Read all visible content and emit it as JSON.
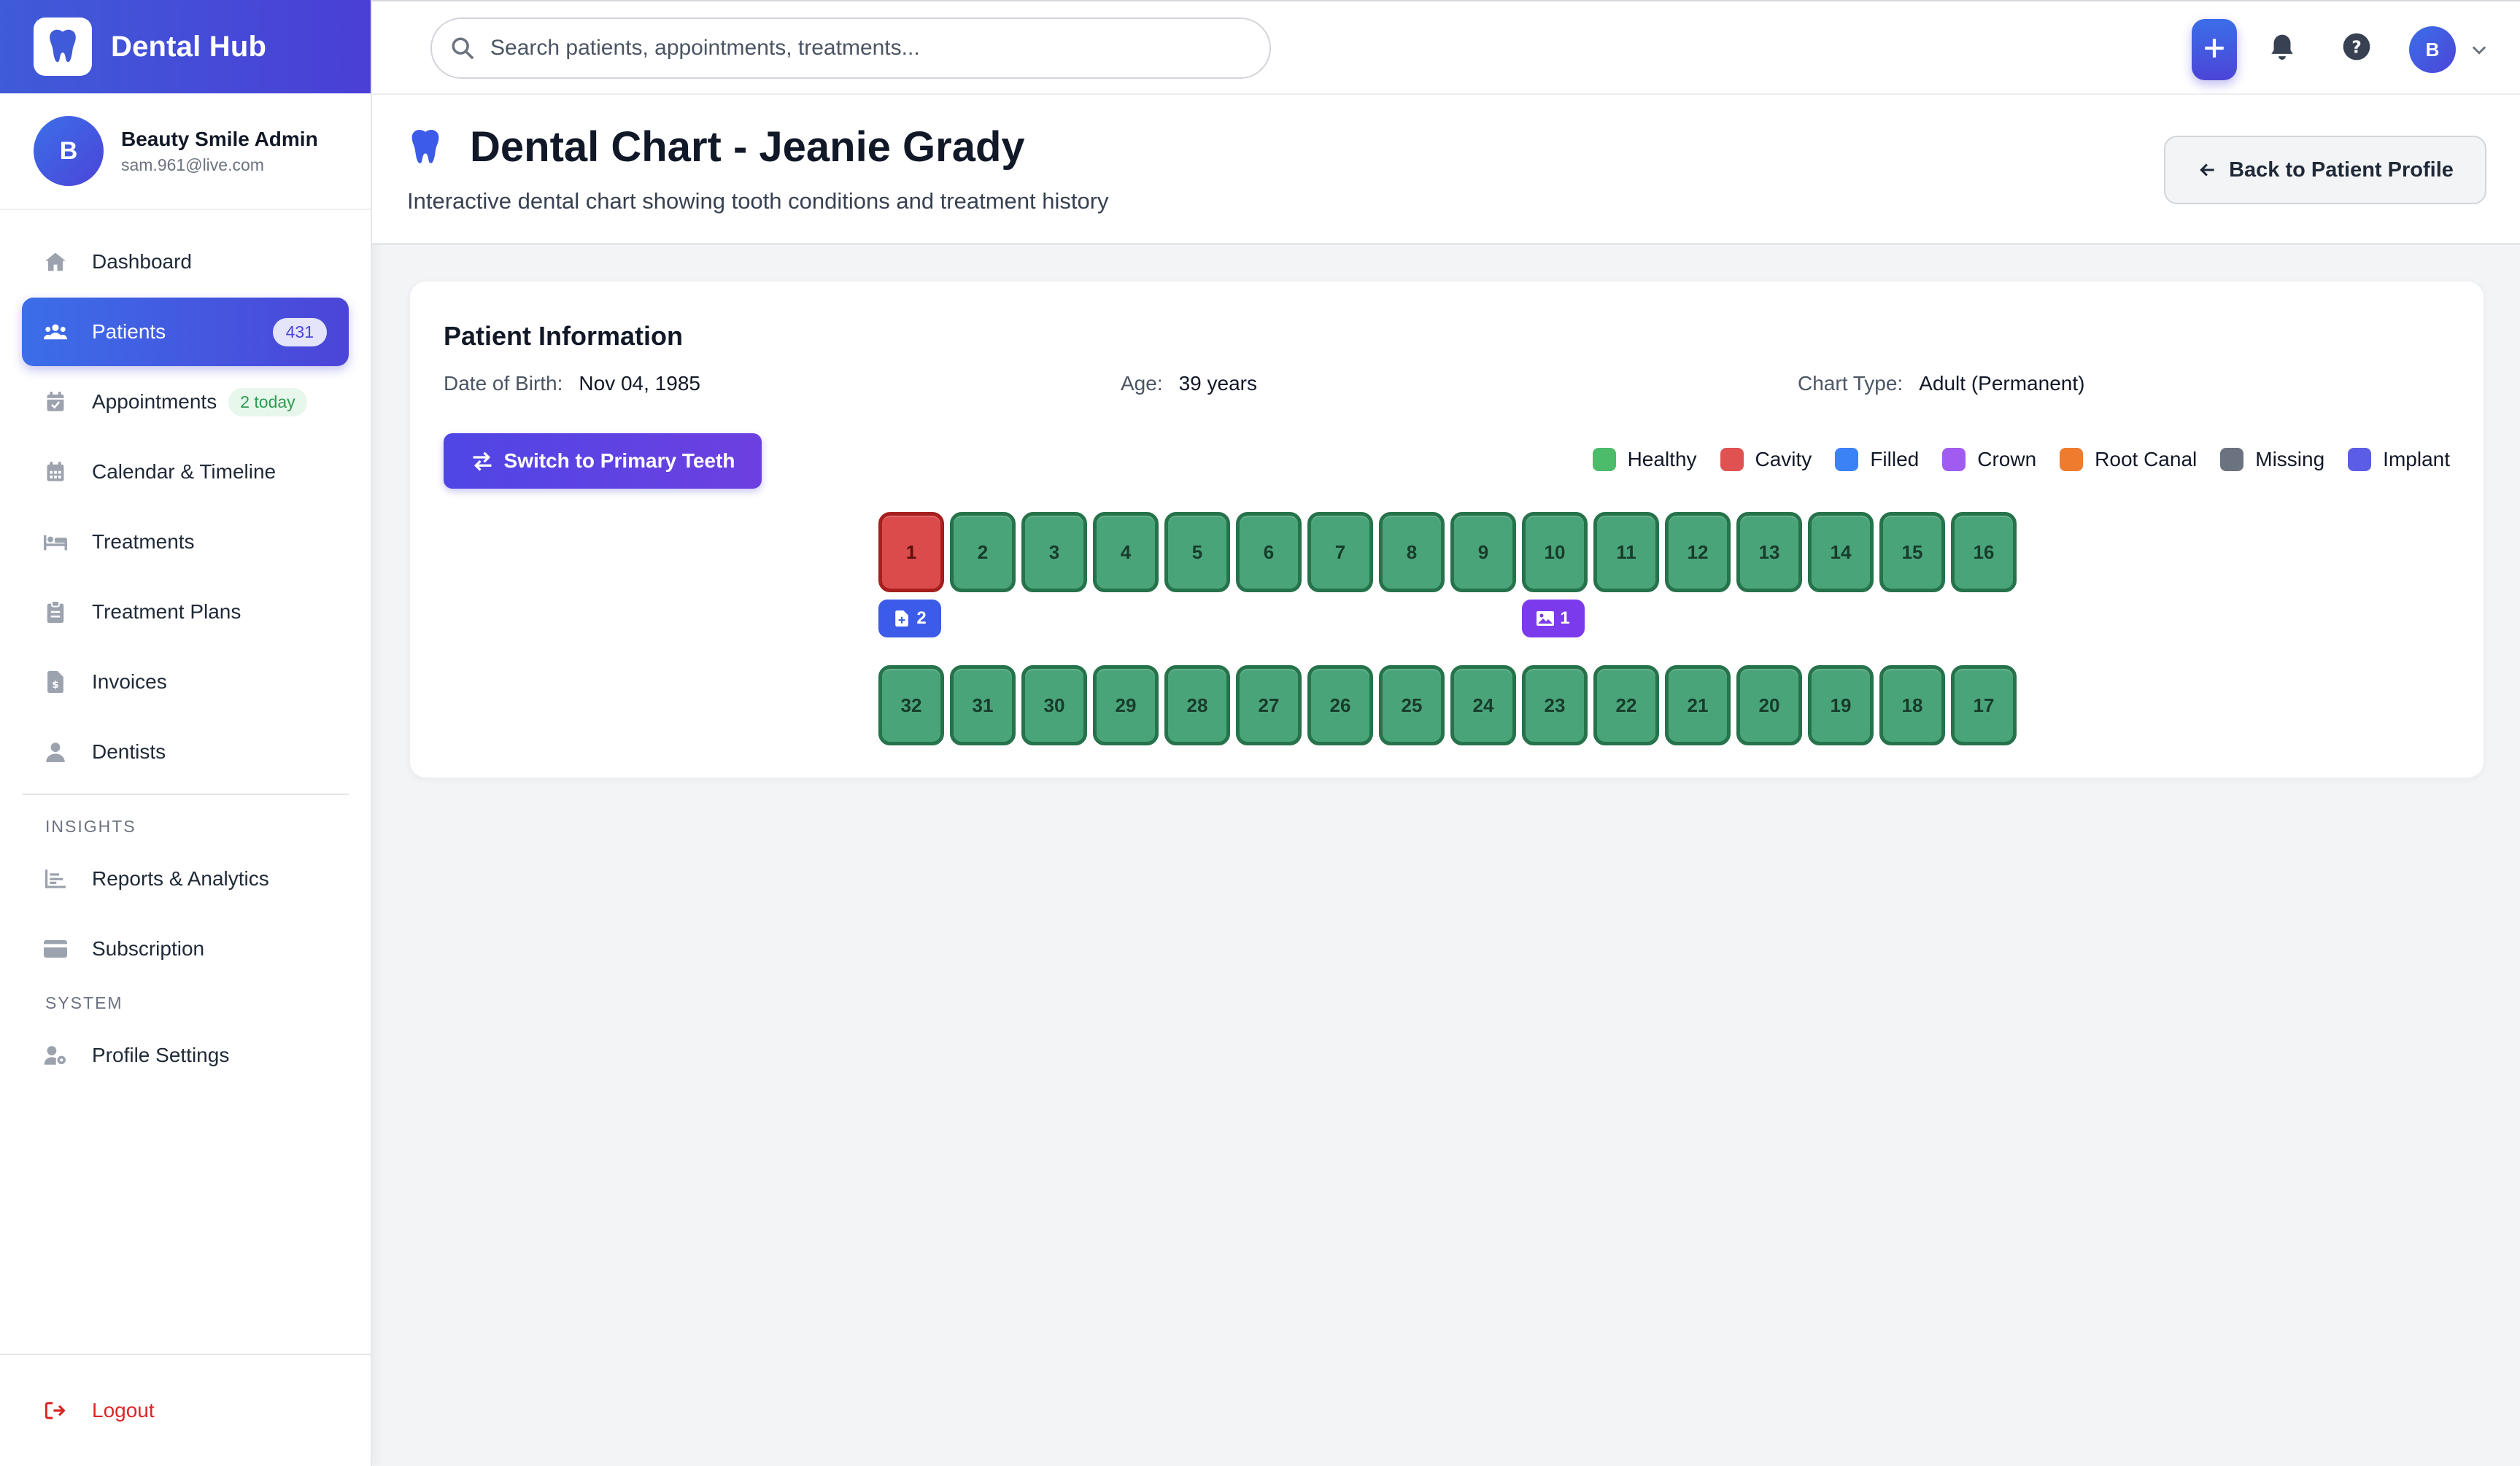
{
  "brand": {
    "name": "Dental Hub"
  },
  "user": {
    "initial": "B",
    "name": "Beauty Smile Admin",
    "email": "sam.961@live.com"
  },
  "nav": {
    "items": [
      {
        "label": "Dashboard",
        "icon": "home-icon"
      },
      {
        "label": "Patients",
        "icon": "users-icon",
        "badge": "431",
        "active": true
      },
      {
        "label": "Appointments",
        "icon": "calendar-check-icon",
        "badge": "2 today"
      },
      {
        "label": "Calendar & Timeline",
        "icon": "calendar-icon"
      },
      {
        "label": "Treatments",
        "icon": "treatment-bed-icon"
      },
      {
        "label": "Treatment Plans",
        "icon": "clipboard-icon"
      },
      {
        "label": "Invoices",
        "icon": "invoice-icon"
      },
      {
        "label": "Dentists",
        "icon": "user-md-icon"
      }
    ],
    "insights_label": "INSIGHTS",
    "insights": [
      {
        "label": "Reports & Analytics",
        "icon": "chart-icon"
      },
      {
        "label": "Subscription",
        "icon": "credit-card-icon"
      }
    ],
    "system_label": "SYSTEM",
    "system": [
      {
        "label": "Profile Settings",
        "icon": "user-cog-icon"
      }
    ],
    "logout": "Logout"
  },
  "topbar": {
    "search_placeholder": "Search patients, appointments, treatments...",
    "avatar_initial": "B"
  },
  "header": {
    "title": "Dental Chart - Jeanie Grady",
    "subtitle": "Interactive dental chart showing tooth conditions and treatment history",
    "back_label": "Back to Patient Profile"
  },
  "patient_info": {
    "title": "Patient Information",
    "dob_label": "Date of Birth:",
    "dob_value": "Nov 04, 1985",
    "age_label": "Age:",
    "age_value": "39 years",
    "chart_type_label": "Chart Type:",
    "chart_type_value": "Adult (Permanent)"
  },
  "chart": {
    "switch_label": "Switch to Primary Teeth",
    "legend": [
      {
        "label": "Healthy",
        "color": "#4cbc6a"
      },
      {
        "label": "Cavity",
        "color": "#e05252"
      },
      {
        "label": "Filled",
        "color": "#3b82f6"
      },
      {
        "label": "Crown",
        "color": "#a05cf0"
      },
      {
        "label": "Root Canal",
        "color": "#ef7b2e"
      },
      {
        "label": "Missing",
        "color": "#6b7280"
      },
      {
        "label": "Implant",
        "color": "#5b5de6"
      }
    ],
    "upper": [
      {
        "n": "1",
        "status": "cavity"
      },
      {
        "n": "2",
        "status": "healthy"
      },
      {
        "n": "3",
        "status": "healthy"
      },
      {
        "n": "4",
        "status": "healthy"
      },
      {
        "n": "5",
        "status": "healthy"
      },
      {
        "n": "6",
        "status": "healthy"
      },
      {
        "n": "7",
        "status": "healthy"
      },
      {
        "n": "8",
        "status": "healthy"
      },
      {
        "n": "9",
        "status": "healthy"
      },
      {
        "n": "10",
        "status": "healthy"
      },
      {
        "n": "11",
        "status": "healthy"
      },
      {
        "n": "12",
        "status": "healthy"
      },
      {
        "n": "13",
        "status": "healthy"
      },
      {
        "n": "14",
        "status": "healthy"
      },
      {
        "n": "15",
        "status": "healthy"
      },
      {
        "n": "16",
        "status": "healthy"
      }
    ],
    "lower": [
      {
        "n": "32",
        "status": "healthy"
      },
      {
        "n": "31",
        "status": "healthy"
      },
      {
        "n": "30",
        "status": "healthy"
      },
      {
        "n": "29",
        "status": "healthy"
      },
      {
        "n": "28",
        "status": "healthy"
      },
      {
        "n": "27",
        "status": "healthy"
      },
      {
        "n": "26",
        "status": "healthy"
      },
      {
        "n": "25",
        "status": "healthy"
      },
      {
        "n": "24",
        "status": "healthy"
      },
      {
        "n": "23",
        "status": "healthy"
      },
      {
        "n": "22",
        "status": "healthy"
      },
      {
        "n": "21",
        "status": "healthy"
      },
      {
        "n": "20",
        "status": "healthy"
      },
      {
        "n": "19",
        "status": "healthy"
      },
      {
        "n": "18",
        "status": "healthy"
      },
      {
        "n": "17",
        "status": "healthy"
      }
    ],
    "badges": [
      {
        "tooth": "1",
        "count": "2",
        "icon": "document-icon",
        "color": "#3b5be8"
      },
      {
        "tooth": "10",
        "count": "1",
        "icon": "image-icon",
        "color": "#7c3aed"
      }
    ]
  }
}
